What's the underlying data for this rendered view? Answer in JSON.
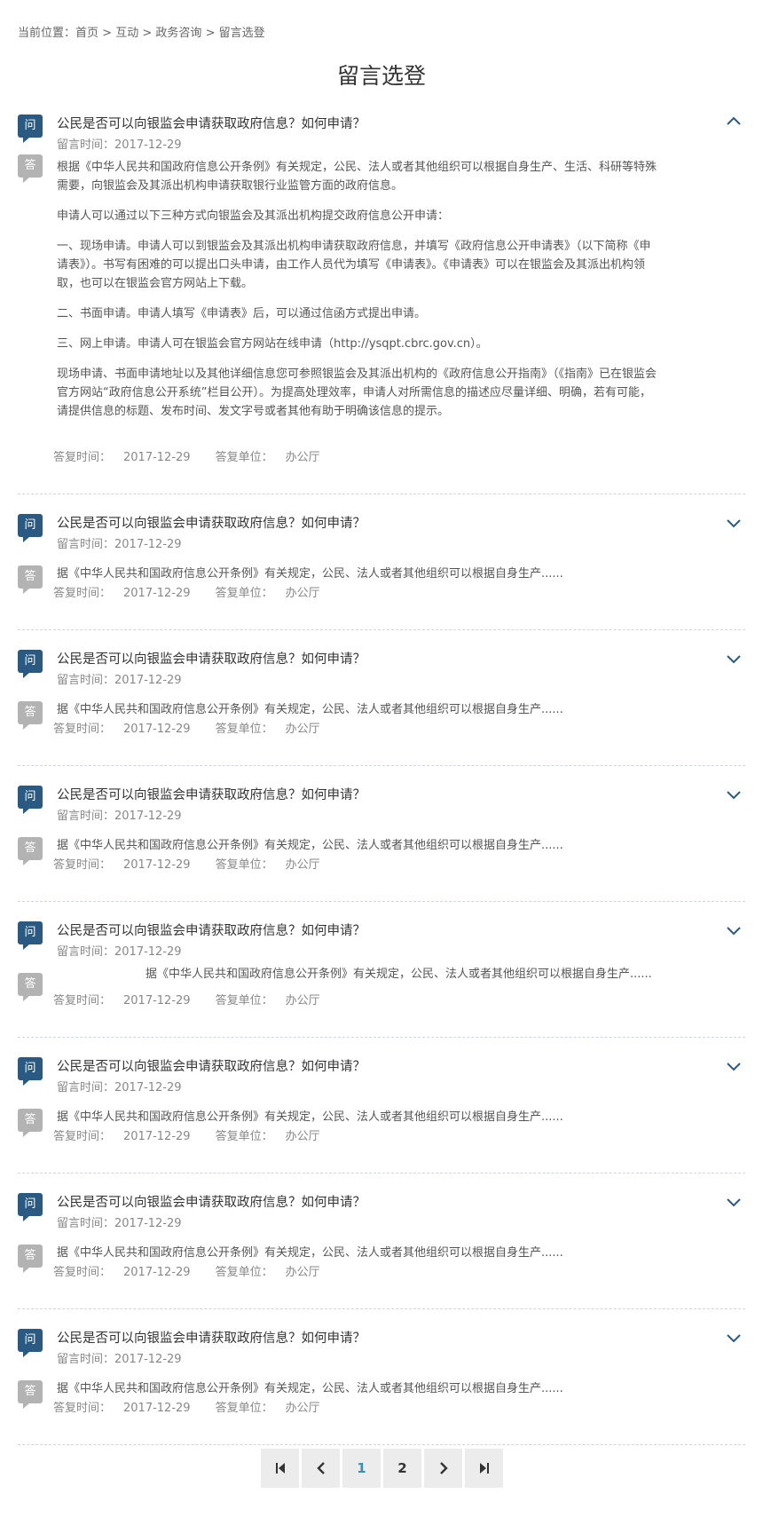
{
  "breadcrumb": {
    "prefix": "当前位置：",
    "items": [
      "首页",
      "互动",
      "政务咨询",
      "留言选登"
    ],
    "separator": ">"
  },
  "page_title": "留言选登",
  "labels": {
    "question_badge": "问",
    "answer_badge": "答",
    "asked_prefix": "留言时间：",
    "replied_prefix": "答复时间：",
    "dept_prefix": "答复单位："
  },
  "items": [
    {
      "question": "公民是否可以向银监会申请获取政府信息？如何申请？",
      "asked": "2017-12-29",
      "expanded": true,
      "answer_paragraphs": [
        "根据《中华人民共和国政府信息公开条例》有关规定，公民、法人或者其他组织可以根据自身生产、生活、科研等特殊需要，向银监会及其派出机构申请获取银行业监管方面的政府信息。",
        "申请人可以通过以下三种方式向银监会及其派出机构提交政府信息公开申请：",
        "一、现场申请。申请人可以到银监会及其派出机构申请获取政府信息，并填写《政府信息公开申请表》（以下简称《申请表》）。书写有困难的可以提出口头申请，由工作人员代为填写《申请表》。《申请表》可以在银监会及其派出机构领取，也可以在银监会官方网站上下载。",
        "二、书面申请。申请人填写《申请表》后，可以通过信函方式提出申请。",
        "三、网上申请。申请人可在银监会官方网站在线申请（http://ysqpt.cbrc.gov.cn）。",
        "现场申请、书面申请地址以及其他详细信息您可参照银监会及其派出机构的《政府信息公开指南》（《指南》已在银监会官方网站“政府信息公开系统”栏目公开）。为提高处理效率，申请人对所需信息的描述应尽量详细、明确，若有可能，请提供信息的标题、发布时间、发文字号或者其他有助于明确该信息的提示。"
      ],
      "replied": "2017-12-29",
      "dept": "办公厅"
    },
    {
      "question": "公民是否可以向银监会申请获取政府信息？如何申请？",
      "asked": "2017-12-29",
      "expanded": false,
      "summary": "据《中华人民共和国政府信息公开条例》有关规定，公民、法人或者其他组织可以根据自身生产......",
      "replied": "2017-12-29",
      "dept": "办公厅"
    },
    {
      "question": "公民是否可以向银监会申请获取政府信息？如何申请？",
      "asked": "2017-12-29",
      "expanded": false,
      "summary": "据《中华人民共和国政府信息公开条例》有关规定，公民、法人或者其他组织可以根据自身生产......",
      "replied": "2017-12-29",
      "dept": "办公厅"
    },
    {
      "question": "公民是否可以向银监会申请获取政府信息？如何申请？",
      "asked": "2017-12-29",
      "expanded": false,
      "summary": "据《中华人民共和国政府信息公开条例》有关规定，公民、法人或者其他组织可以根据自身生产......",
      "replied": "2017-12-29",
      "dept": "办公厅"
    },
    {
      "question": "公民是否可以向银监会申请获取政府信息？如何申请？",
      "asked": "2017-12-29",
      "expanded": false,
      "summary": "据《中华人民共和国政府信息公开条例》有关规定，公民、法人或者其他组织可以根据自身生产......",
      "replied": "2017-12-29",
      "dept": "办公厅"
    },
    {
      "question": "公民是否可以向银监会申请获取政府信息？如何申请？",
      "asked": "2017-12-29",
      "expanded": false,
      "summary": "据《中华人民共和国政府信息公开条例》有关规定，公民、法人或者其他组织可以根据自身生产......",
      "replied": "2017-12-29",
      "dept": "办公厅"
    },
    {
      "question": "公民是否可以向银监会申请获取政府信息？如何申请？",
      "asked": "2017-12-29",
      "expanded": false,
      "summary": "据《中华人民共和国政府信息公开条例》有关规定，公民、法人或者其他组织可以根据自身生产......",
      "replied": "2017-12-29",
      "dept": "办公厅"
    },
    {
      "question": "公民是否可以向银监会申请获取政府信息？如何申请？",
      "asked": "2017-12-29",
      "expanded": false,
      "summary": "据《中华人民共和国政府信息公开条例》有关规定，公民、法人或者其他组织可以根据自身生产......",
      "replied": "2017-12-29",
      "dept": "办公厅"
    }
  ],
  "pagination": {
    "first_icon": "first-page-icon",
    "prev_icon": "prev-page-icon",
    "pages": [
      "1",
      "2"
    ],
    "current": "1",
    "next_icon": "next-page-icon",
    "last_icon": "last-page-icon"
  },
  "colors": {
    "question_badge": "#2a5a82",
    "answer_badge": "#b3b3b3",
    "chevron": "#2a5a82",
    "current_page": "#3a8fb0"
  }
}
